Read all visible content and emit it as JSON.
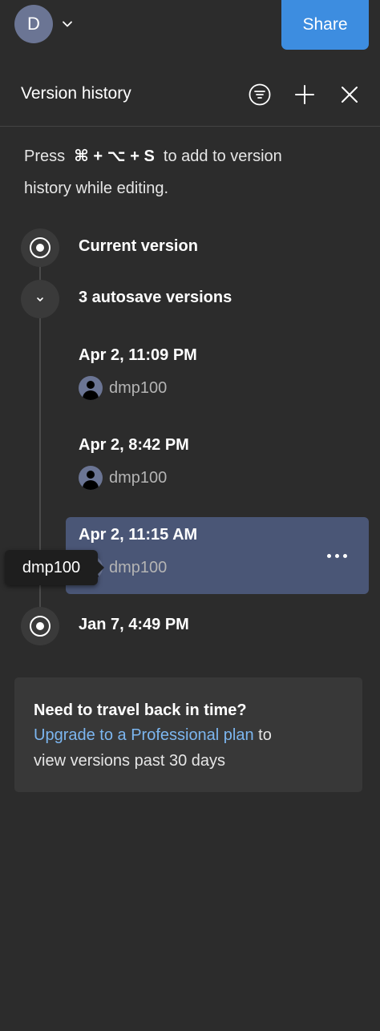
{
  "header": {
    "avatar_initial": "D",
    "share_label": "Share"
  },
  "panel": {
    "title": "Version history",
    "icons": [
      "filter-icon",
      "add-icon",
      "close-icon"
    ]
  },
  "hint": {
    "prefix": "Press",
    "shortcut": "⌘ + ⌥ + S",
    "suffix_line1": "to add to version",
    "line2": "history while editing."
  },
  "timeline": {
    "current_label": "Current version",
    "autosave_group_label": "3 autosave versions",
    "autosave_versions": [
      {
        "timestamp": "Apr 2, 11:09 PM",
        "user": "dmp100"
      },
      {
        "timestamp": "Apr 2, 8:42 PM",
        "user": "dmp100"
      },
      {
        "timestamp": "Apr 2, 11:15 AM",
        "user": "dmp100",
        "selected": true
      }
    ],
    "older_version": {
      "timestamp": "Jan 7, 4:49 PM"
    }
  },
  "tooltip": {
    "text": "dmp100"
  },
  "upgrade": {
    "heading": "Need to travel back in time?",
    "link_text": "Upgrade to a Professional plan",
    "after_link": " to",
    "line3": "view versions past 30 days"
  },
  "colors": {
    "background": "#2c2c2c",
    "accent": "#3d8de0",
    "selected_row": "#4a5676",
    "link": "#7cb6f0"
  }
}
